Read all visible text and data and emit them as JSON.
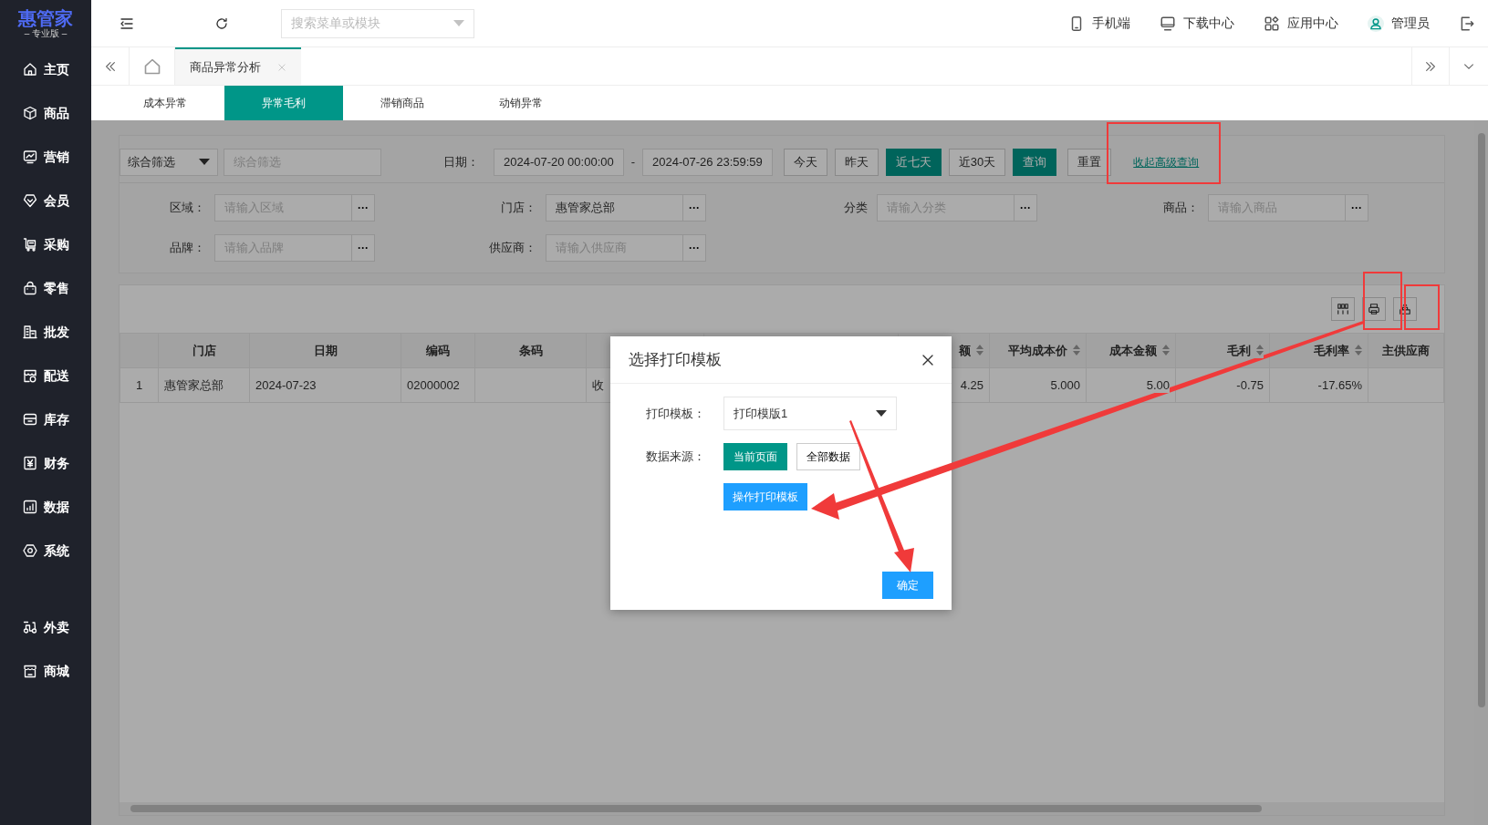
{
  "logo": {
    "title": "惠管家",
    "subtitle": "– 专业版 –"
  },
  "sidebar": {
    "items": [
      {
        "label": "主页"
      },
      {
        "label": "商品"
      },
      {
        "label": "营销"
      },
      {
        "label": "会员"
      },
      {
        "label": "采购"
      },
      {
        "label": "零售"
      },
      {
        "label": "批发"
      },
      {
        "label": "配送"
      },
      {
        "label": "库存"
      },
      {
        "label": "财务"
      },
      {
        "label": "数据"
      },
      {
        "label": "系统"
      }
    ],
    "bottom_items": [
      {
        "label": "外卖"
      },
      {
        "label": "商城"
      }
    ]
  },
  "topbar": {
    "search": {
      "placeholder": "搜索菜单或模块"
    },
    "links": [
      "手机端",
      "下载中心",
      "应用中心",
      "管理员"
    ]
  },
  "page_tabs": [
    {
      "label": "商品异常分析",
      "selected": true
    }
  ],
  "sub_tabs": [
    {
      "label": "成本异常",
      "selected": false
    },
    {
      "label": "异常毛利",
      "selected": true
    },
    {
      "label": "滞销商品",
      "selected": false
    },
    {
      "label": "动销异常",
      "selected": false
    }
  ],
  "filters": {
    "mode": "综合筛选",
    "mode_placeholder": "综合筛选",
    "date_label": "日期：",
    "date_from": "2024-07-20 00:00:00",
    "date_sep": "-",
    "date_to": "2024-07-26 23:59:59",
    "quick": [
      {
        "label": "今天",
        "selected": false
      },
      {
        "label": "昨天",
        "selected": false
      },
      {
        "label": "近七天",
        "selected": true
      },
      {
        "label": "近30天",
        "selected": false
      }
    ],
    "query": "查询",
    "reset": "重置",
    "collapse": "收起高级查询",
    "fields": [
      {
        "label": "区域：",
        "placeholder": "请输入区域",
        "more": "···"
      },
      {
        "label": "门店：",
        "value": "惠管家总部",
        "more": "···"
      },
      {
        "label": "分类",
        "placeholder": "请输入分类",
        "more": "···"
      },
      {
        "label": "商品：",
        "placeholder": "请输入商品",
        "more": "···"
      },
      {
        "label": "品牌：",
        "placeholder": "请输入品牌",
        "more": "···"
      },
      {
        "label": "供应商：",
        "placeholder": "请输入供应商",
        "more": "···"
      }
    ]
  },
  "table": {
    "columns": [
      {},
      {
        "label": "门店",
        "sortable": false
      },
      {
        "label": "日期",
        "sortable": false
      },
      {
        "label": "编码",
        "sortable": false
      },
      {
        "label": "条码",
        "sortable": false
      },
      {},
      {},
      {
        "label": "额",
        "sortable": true
      },
      {
        "label": "平均成本价",
        "sortable": true
      },
      {
        "label": "成本金额",
        "sortable": true
      },
      {
        "label": "毛利",
        "sortable": true
      },
      {
        "label": "毛利率",
        "sortable": true
      },
      {
        "label": "主供应商",
        "sortable": false
      }
    ],
    "rows": [
      {
        "cells": [
          "1",
          "惠管家总部",
          "2024-07-23",
          "02000002",
          null,
          "收",
          null,
          "4.25",
          "5.000",
          "5.00",
          "-0.75",
          "-17.65%",
          null
        ]
      }
    ]
  },
  "dialog": {
    "title": "选择打印模板",
    "template_label": "打印模板：",
    "template": "打印模版1",
    "source_label": "数据来源：",
    "sources": [
      {
        "label": "当前页面",
        "selected": true
      },
      {
        "label": "全部数据",
        "selected": false
      }
    ],
    "edit_button": "操作打印模板",
    "ok_button": "确定"
  }
}
